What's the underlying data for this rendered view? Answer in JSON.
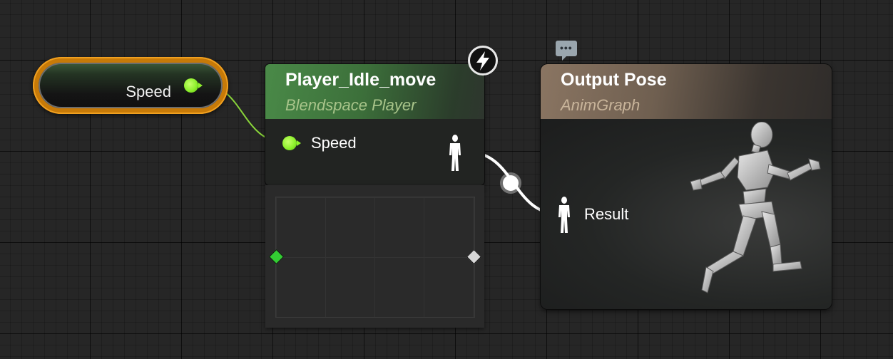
{
  "graph": {
    "variable_node": {
      "label": "Speed",
      "pin_icon": "float-pin-icon"
    },
    "blendspace_node": {
      "title": "Player_Idle_move",
      "subtitle": "Blendspace Player",
      "input_pin_label": "Speed",
      "output_pin_icon": "pose-pin-icon",
      "event_icon": "lightning-icon"
    },
    "output_node": {
      "title": "Output Pose",
      "subtitle": "AnimGraph",
      "input_pin_label": "Result",
      "comment_icon": "comment-bubble-icon",
      "preview_icon": "running-mannequin-icon"
    }
  },
  "colors": {
    "float_pin": "#8ef02d",
    "variable_node_border": "#f0a020",
    "blendspace_header": "#4a8a48",
    "output_header": "#8a7562",
    "pose_wire": "#ffffff",
    "blend_sample_start": "#33cc33",
    "blend_sample_end": "#d8d8d8"
  }
}
